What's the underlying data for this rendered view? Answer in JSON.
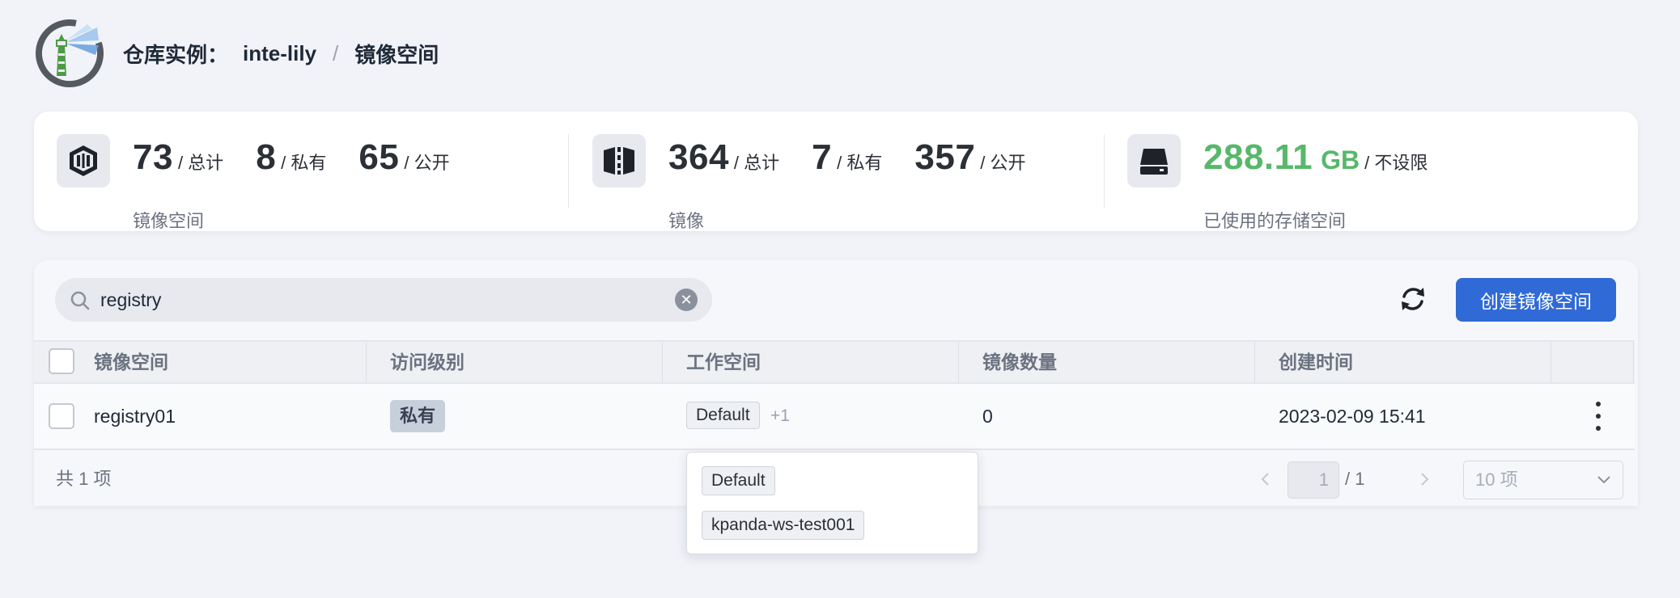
{
  "header": {
    "instance_label": "仓库实例：",
    "instance_name": "inte-lily",
    "separator": "/",
    "page": "镜像空间"
  },
  "stats": {
    "namespaces": {
      "total": "73",
      "total_label": "/ 总计",
      "private": "8",
      "private_label": "/ 私有",
      "public": "65",
      "public_label": "/ 公开",
      "caption": "镜像空间",
      "icon": "namespace-icon"
    },
    "images": {
      "total": "364",
      "total_label": "/ 总计",
      "private": "7",
      "private_label": "/ 私有",
      "public": "357",
      "public_label": "/ 公开",
      "caption": "镜像",
      "icon": "image-icon"
    },
    "storage": {
      "used": "288.11",
      "unit": "GB",
      "limit_label": "/ 不设限",
      "caption": "已使用的存储空间",
      "icon": "storage-icon",
      "color": "#57b86a"
    }
  },
  "toolbar": {
    "search_value": "registry",
    "create_label": "创建镜像空间",
    "accent": "#2f6ad6"
  },
  "table": {
    "headers": [
      "镜像空间",
      "访问级别",
      "工作空间",
      "镜像数量",
      "创建时间"
    ],
    "rows": [
      {
        "name": "registry01",
        "access": "私有",
        "workspace": "Default",
        "workspace_more": "+1",
        "image_count": "0",
        "created": "2023-02-09 15:41"
      }
    ]
  },
  "footer": {
    "total": "共 1 项",
    "page": "1",
    "page_total": "/ 1",
    "page_size": "10 项"
  },
  "popover": {
    "workspaces": [
      "Default",
      "kpanda-ws-test001"
    ]
  }
}
